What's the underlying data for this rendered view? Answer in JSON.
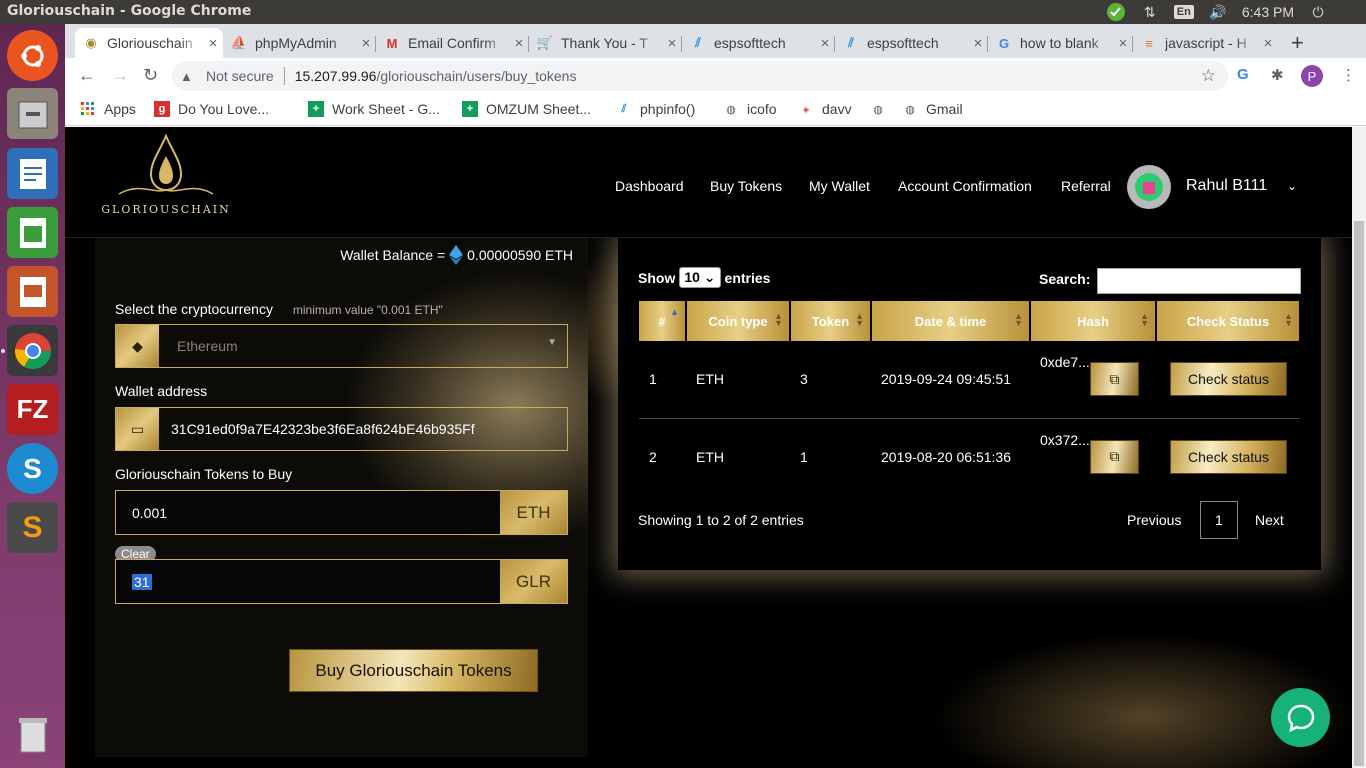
{
  "os": {
    "window_title": "Glorious​chain - Google Chrome",
    "keyboard_layout": "En",
    "clock": "6:43 PM"
  },
  "tabs": [
    {
      "label": "Gloriouschain",
      "x_close": "×"
    },
    {
      "label": "phpMyAdmin",
      "x_close": "×"
    },
    {
      "label": "Email Confirm",
      "x_close": "×"
    },
    {
      "label": "Thank You - T",
      "x_close": "×"
    },
    {
      "label": "espsofttech",
      "x_close": "×"
    },
    {
      "label": "espsofttech",
      "x_close": "×"
    },
    {
      "label": "how to blank",
      "x_close": "×"
    },
    {
      "label": "javascript - H",
      "x_close": "×"
    }
  ],
  "new_tab": "+",
  "omnibox": {
    "security": "Not secure",
    "host": "15.207.99.96",
    "path": "/gloriouschain/users/buy_tokens"
  },
  "profile_initial": "P",
  "bookmarks": [
    {
      "label": "Apps"
    },
    {
      "label": "Do You Love..."
    },
    {
      "label": "Work Sheet - G..."
    },
    {
      "label": "OMZUM Sheet..."
    },
    {
      "label": "phpinfo()"
    },
    {
      "label": "icofo"
    },
    {
      "label": "davv"
    },
    {
      "label": ""
    },
    {
      "label": "Gmail"
    }
  ],
  "site": {
    "logo_text": "GLORIOUSCHAIN",
    "nav": [
      "Dashboard",
      "Buy Tokens",
      "My Wallet",
      "Account Confirmation",
      "Referral"
    ],
    "user_name": "Rahul B111"
  },
  "buy_form": {
    "wallet_balance_label": "Wallet Balance =",
    "wallet_balance_value": "0.00000590 ETH",
    "crypto_label": "Select the cryptocurrency",
    "crypto_hint": "minimum value \"0.001 ETH\"",
    "crypto_placeholder": "Ethereum",
    "wallet_label": "Wallet address",
    "wallet_address": "31C91ed0f9a7E42323be3f6Ea8f624bE46b935Ff",
    "tokens_label": "Gloriouschain Tokens to Buy",
    "eth_amount": "0.001",
    "eth_unit": "ETH",
    "clear_label": "Clear",
    "glr_amount": "31",
    "glr_unit": "GLR",
    "buy_button": "Buy Gloriouschain Tokens"
  },
  "table": {
    "show_label": "Show",
    "entries_count": "10",
    "entries_label": "entries",
    "search_label": "Search:",
    "headers": [
      "#",
      "Coin type",
      "Token",
      "Date & time",
      "Hash",
      "Check Status"
    ],
    "rows": [
      {
        "num": "1",
        "coin": "ETH",
        "token": "3",
        "datetime": "2019-09-24 09:45:51",
        "hash": "0xde7...",
        "action": "Check status"
      },
      {
        "num": "2",
        "coin": "ETH",
        "token": "1",
        "datetime": "2019-08-20 06:51:36",
        "hash": "0x372...",
        "action": "Check status"
      }
    ],
    "showing": "Showing 1 to 2 of 2 entries",
    "prev": "Previous",
    "page": "1",
    "next": "Next"
  },
  "colors": {
    "gold": "#c9a447",
    "launcher": "#5e2750",
    "chat": "#16b27a"
  }
}
